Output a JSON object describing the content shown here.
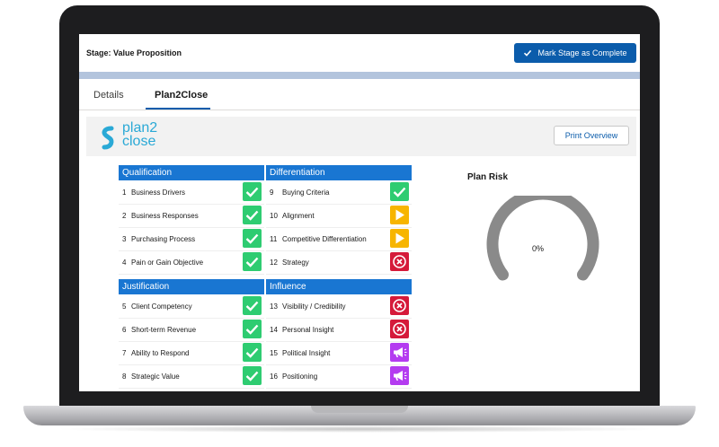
{
  "stage": {
    "title": "Stage: Value Proposition",
    "mark_complete_label": "Mark Stage as Complete"
  },
  "tabs": [
    {
      "label": "Details"
    },
    {
      "label": "Plan2Close"
    }
  ],
  "logo": {
    "line1": "plan2",
    "line2": "close"
  },
  "print_label": "Print Overview",
  "sections": [
    {
      "title": "Qualification",
      "items": [
        {
          "num": "1",
          "label": "Business Drivers",
          "status": "check"
        },
        {
          "num": "2",
          "label": "Business Responses",
          "status": "check"
        },
        {
          "num": "3",
          "label": "Purchasing Process",
          "status": "check"
        },
        {
          "num": "4",
          "label": "Pain or Gain Objective",
          "status": "check"
        }
      ]
    },
    {
      "title": "Differentiation",
      "items": [
        {
          "num": "9",
          "label": "Buying Criteria",
          "status": "check"
        },
        {
          "num": "10",
          "label": "Alignment",
          "status": "play"
        },
        {
          "num": "11",
          "label": "Competitive Differentiation",
          "status": "play"
        },
        {
          "num": "12",
          "label": "Strategy",
          "status": "x"
        }
      ]
    },
    {
      "title": "Justification",
      "items": [
        {
          "num": "5",
          "label": "Client Competency",
          "status": "check"
        },
        {
          "num": "6",
          "label": "Short-term Revenue",
          "status": "check"
        },
        {
          "num": "7",
          "label": "Ability to Respond",
          "status": "check"
        },
        {
          "num": "8",
          "label": "Strategic Value",
          "status": "check"
        }
      ]
    },
    {
      "title": "Influence",
      "items": [
        {
          "num": "13",
          "label": "Visibility / Credibility",
          "status": "x"
        },
        {
          "num": "14",
          "label": "Personal Insight",
          "status": "x"
        },
        {
          "num": "15",
          "label": "Political Insight",
          "status": "megaphone"
        },
        {
          "num": "16",
          "label": "Positioning",
          "status": "megaphone"
        }
      ]
    }
  ],
  "plan_risk": {
    "title": "Plan Risk",
    "value": "0%"
  },
  "colors": {
    "accent": "#0b5cab",
    "section_header": "#1976d2",
    "check": "#2ecc71",
    "warning": "#f7b500",
    "error": "#d51a3a",
    "megaphone": "#b43cf0",
    "gauge": "#8a8a8a"
  },
  "icons": {
    "check": "checkmark-icon",
    "play": "play-icon",
    "x": "close-circle-icon",
    "megaphone": "megaphone-icon"
  }
}
